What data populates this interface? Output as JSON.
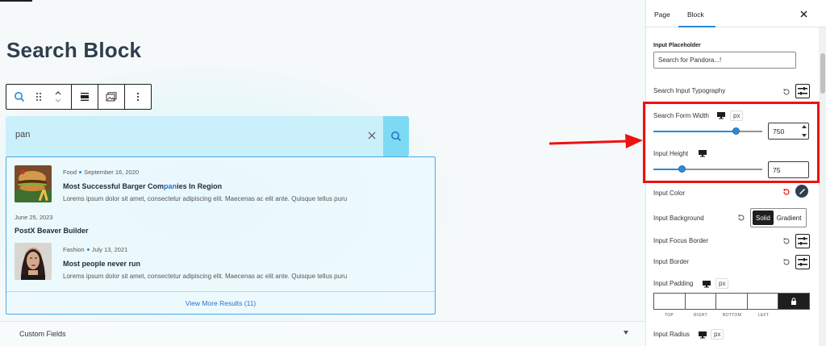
{
  "editor": {
    "title": "Search Block",
    "search": {
      "value": "pan"
    },
    "results": [
      {
        "category": "Food",
        "date": "September 16, 2020",
        "title_pre": "Most Successful Barger Com",
        "title_hl": "pan",
        "title_post": "ies In Region",
        "excerpt": "Lorems ipsum dolor sit amet, consectetur adipiscing elit. Maecenas ac elit ante. Quisque tellus puru"
      },
      {
        "date": "June 25, 2023",
        "title": "PostX Beaver Builder"
      },
      {
        "category": "Fashion",
        "date": "July 13, 2021",
        "title": "Most people never run",
        "excerpt": "Lorems ipsum dolor sit amet, consectetur adipiscing elit. Maecenas ac elit ante. Quisque tellus puru"
      }
    ],
    "view_more": "View More Results (11)",
    "custom_fields": "Custom Fields"
  },
  "sidebar": {
    "tabs": [
      "Page",
      "Block"
    ],
    "active_tab": "Block",
    "input_placeholder_label": "Input Placeholder",
    "input_placeholder_value": "Search for Pandora...!",
    "typography_label": "Search Input Typography",
    "form_width_label": "Search Form Width",
    "form_width_unit": "px",
    "form_width_value": "750",
    "form_width_fraction": 0.76,
    "input_height_label": "Input Height",
    "input_height_value": "75",
    "input_height_fraction": 0.27,
    "input_color_label": "Input Color",
    "input_background_label": "Input Background",
    "bg_options": [
      "Solid",
      "Gradient"
    ],
    "focus_border_label": "Input Focus Border",
    "border_label": "Input Border",
    "padding_label": "Input Padding",
    "padding_unit": "px",
    "padding_sides": [
      "TOP",
      "RIGHT",
      "BOTTOM",
      "LEFT"
    ],
    "radius_label": "Input Radius",
    "radius_unit": "px"
  },
  "colors": {
    "accent": "#2b8ad8",
    "highlight_red": "#e11111",
    "search_bg": "#c9f0fb",
    "search_button": "#7ed9f4"
  }
}
